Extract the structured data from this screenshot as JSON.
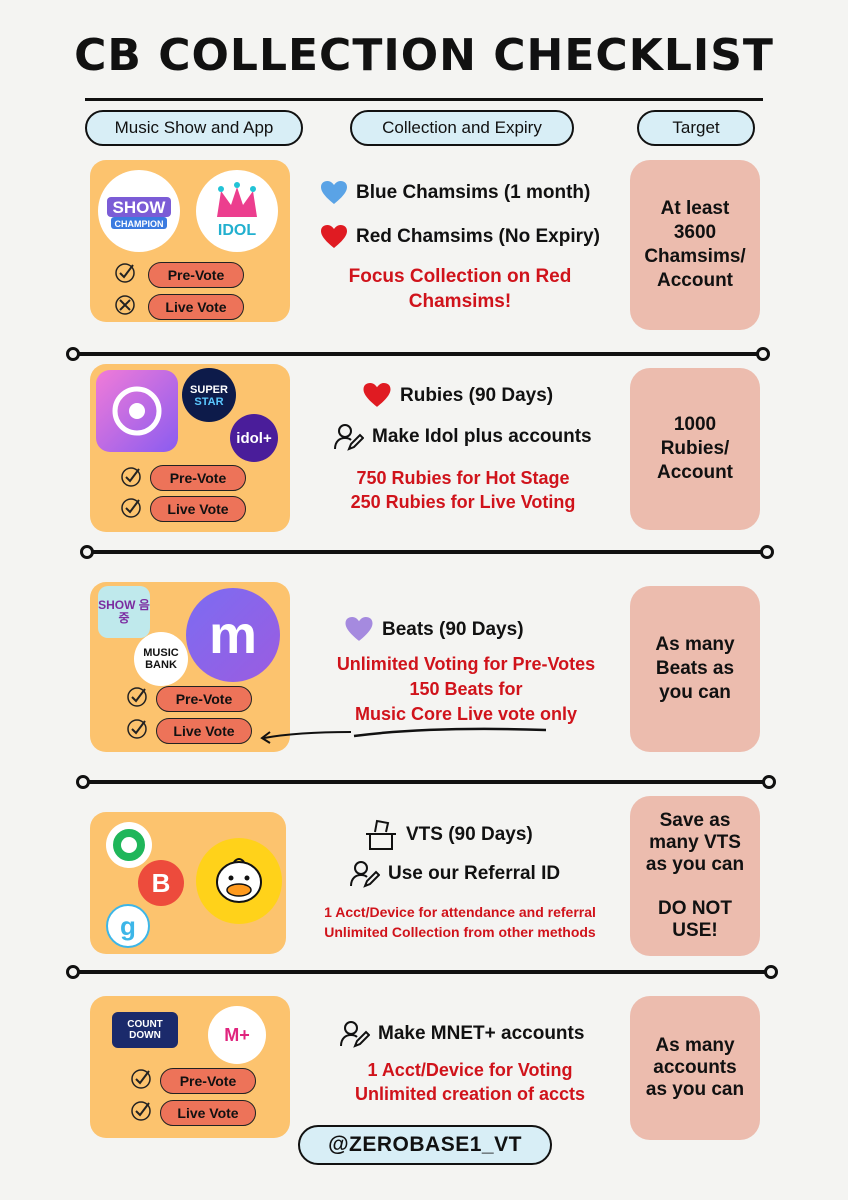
{
  "title": "CB COLLECTION CHECKLIST",
  "columns": [
    "Music Show and App",
    "Collection and Expiry",
    "Target"
  ],
  "colors": {
    "panel": "#fcc36e",
    "pill": "#ed7359",
    "target": "#ecbcae",
    "header_pill": "#d8eef6",
    "accent_red": "#d0131b"
  },
  "sections": [
    {
      "logos": [
        "SHOW CHAMPION",
        "IDOL"
      ],
      "votes": [
        {
          "label": "Pre-Vote",
          "mark": "check"
        },
        {
          "label": "Live Vote",
          "mark": "cross"
        }
      ],
      "lines": [
        {
          "icon": "blue-heart-icon",
          "text": "Blue Chamsims (1 month)"
        },
        {
          "icon": "red-heart-icon",
          "text": "Red Chamsims (No Expiry)"
        }
      ],
      "red": [
        "Focus Collection on Red",
        "Chamsims!"
      ],
      "target": "At least\n3600\nChamsims/\nAccount"
    },
    {
      "logos": [
        "SUPER STAR",
        "idol+"
      ],
      "votes": [
        {
          "label": "Pre-Vote",
          "mark": "check"
        },
        {
          "label": "Live Vote",
          "mark": "check"
        }
      ],
      "lines": [
        {
          "icon": "red-heart-icon",
          "text": "Rubies (90 Days)"
        },
        {
          "icon": "user-edit-icon",
          "text": "Make Idol plus accounts"
        }
      ],
      "red": [
        "750 Rubies for Hot Stage",
        "250 Rubies for Live Voting"
      ],
      "target": "1000\nRubies/\nAccount"
    },
    {
      "logos": [
        "SHOW 음중",
        "MUSIC BANK",
        "m"
      ],
      "votes": [
        {
          "label": "Pre-Vote",
          "mark": "check"
        },
        {
          "label": "Live Vote",
          "mark": "check"
        }
      ],
      "lines": [
        {
          "icon": "purple-heart-icon",
          "text": "Beats (90 Days)"
        }
      ],
      "red": [
        "Unlimited Voting for Pre-Votes",
        "150 Beats for",
        "Music Core Live vote only"
      ],
      "target": "As many\nBeats as\nyou can"
    },
    {
      "logos": [
        "O",
        "B",
        "g"
      ],
      "votes": [],
      "lines": [
        {
          "icon": "ballot-box-icon",
          "text": "VTS (90 Days)"
        },
        {
          "icon": "user-edit-icon",
          "text": "Use our Referral ID"
        }
      ],
      "red": [
        "1 Acct/Device for attendance and referral",
        "Unlimited Collection from other methods"
      ],
      "target": "Save as\nmany VTS\nas you can\n\nDO NOT\nUSE!"
    },
    {
      "logos": [
        "COUNT DOWN",
        "M+"
      ],
      "votes": [
        {
          "label": "Pre-Vote",
          "mark": "check"
        },
        {
          "label": "Live Vote",
          "mark": "check"
        }
      ],
      "lines": [
        {
          "icon": "user-edit-icon",
          "text": "Make MNET+ accounts"
        }
      ],
      "red": [
        "1 Acct/Device for Voting",
        "Unlimited creation of accts"
      ],
      "target": "As many\naccounts\nas you can"
    }
  ],
  "handle": "@ZEROBASE1_VT"
}
